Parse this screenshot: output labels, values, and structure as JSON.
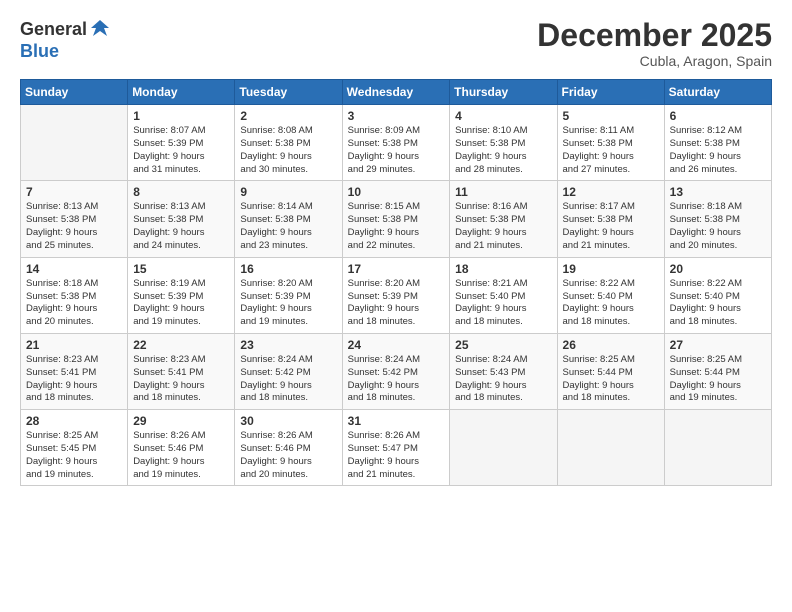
{
  "header": {
    "logo_general": "General",
    "logo_blue": "Blue",
    "month_title": "December 2025",
    "location": "Cubla, Aragon, Spain"
  },
  "weekdays": [
    "Sunday",
    "Monday",
    "Tuesday",
    "Wednesday",
    "Thursday",
    "Friday",
    "Saturday"
  ],
  "weeks": [
    [
      {
        "day": "",
        "info": ""
      },
      {
        "day": "1",
        "info": "Sunrise: 8:07 AM\nSunset: 5:39 PM\nDaylight: 9 hours\nand 31 minutes."
      },
      {
        "day": "2",
        "info": "Sunrise: 8:08 AM\nSunset: 5:38 PM\nDaylight: 9 hours\nand 30 minutes."
      },
      {
        "day": "3",
        "info": "Sunrise: 8:09 AM\nSunset: 5:38 PM\nDaylight: 9 hours\nand 29 minutes."
      },
      {
        "day": "4",
        "info": "Sunrise: 8:10 AM\nSunset: 5:38 PM\nDaylight: 9 hours\nand 28 minutes."
      },
      {
        "day": "5",
        "info": "Sunrise: 8:11 AM\nSunset: 5:38 PM\nDaylight: 9 hours\nand 27 minutes."
      },
      {
        "day": "6",
        "info": "Sunrise: 8:12 AM\nSunset: 5:38 PM\nDaylight: 9 hours\nand 26 minutes."
      }
    ],
    [
      {
        "day": "7",
        "info": "Sunrise: 8:13 AM\nSunset: 5:38 PM\nDaylight: 9 hours\nand 25 minutes."
      },
      {
        "day": "8",
        "info": "Sunrise: 8:13 AM\nSunset: 5:38 PM\nDaylight: 9 hours\nand 24 minutes."
      },
      {
        "day": "9",
        "info": "Sunrise: 8:14 AM\nSunset: 5:38 PM\nDaylight: 9 hours\nand 23 minutes."
      },
      {
        "day": "10",
        "info": "Sunrise: 8:15 AM\nSunset: 5:38 PM\nDaylight: 9 hours\nand 22 minutes."
      },
      {
        "day": "11",
        "info": "Sunrise: 8:16 AM\nSunset: 5:38 PM\nDaylight: 9 hours\nand 21 minutes."
      },
      {
        "day": "12",
        "info": "Sunrise: 8:17 AM\nSunset: 5:38 PM\nDaylight: 9 hours\nand 21 minutes."
      },
      {
        "day": "13",
        "info": "Sunrise: 8:18 AM\nSunset: 5:38 PM\nDaylight: 9 hours\nand 20 minutes."
      }
    ],
    [
      {
        "day": "14",
        "info": "Sunrise: 8:18 AM\nSunset: 5:38 PM\nDaylight: 9 hours\nand 20 minutes."
      },
      {
        "day": "15",
        "info": "Sunrise: 8:19 AM\nSunset: 5:39 PM\nDaylight: 9 hours\nand 19 minutes."
      },
      {
        "day": "16",
        "info": "Sunrise: 8:20 AM\nSunset: 5:39 PM\nDaylight: 9 hours\nand 19 minutes."
      },
      {
        "day": "17",
        "info": "Sunrise: 8:20 AM\nSunset: 5:39 PM\nDaylight: 9 hours\nand 18 minutes."
      },
      {
        "day": "18",
        "info": "Sunrise: 8:21 AM\nSunset: 5:40 PM\nDaylight: 9 hours\nand 18 minutes."
      },
      {
        "day": "19",
        "info": "Sunrise: 8:22 AM\nSunset: 5:40 PM\nDaylight: 9 hours\nand 18 minutes."
      },
      {
        "day": "20",
        "info": "Sunrise: 8:22 AM\nSunset: 5:40 PM\nDaylight: 9 hours\nand 18 minutes."
      }
    ],
    [
      {
        "day": "21",
        "info": "Sunrise: 8:23 AM\nSunset: 5:41 PM\nDaylight: 9 hours\nand 18 minutes."
      },
      {
        "day": "22",
        "info": "Sunrise: 8:23 AM\nSunset: 5:41 PM\nDaylight: 9 hours\nand 18 minutes."
      },
      {
        "day": "23",
        "info": "Sunrise: 8:24 AM\nSunset: 5:42 PM\nDaylight: 9 hours\nand 18 minutes."
      },
      {
        "day": "24",
        "info": "Sunrise: 8:24 AM\nSunset: 5:42 PM\nDaylight: 9 hours\nand 18 minutes."
      },
      {
        "day": "25",
        "info": "Sunrise: 8:24 AM\nSunset: 5:43 PM\nDaylight: 9 hours\nand 18 minutes."
      },
      {
        "day": "26",
        "info": "Sunrise: 8:25 AM\nSunset: 5:44 PM\nDaylight: 9 hours\nand 18 minutes."
      },
      {
        "day": "27",
        "info": "Sunrise: 8:25 AM\nSunset: 5:44 PM\nDaylight: 9 hours\nand 19 minutes."
      }
    ],
    [
      {
        "day": "28",
        "info": "Sunrise: 8:25 AM\nSunset: 5:45 PM\nDaylight: 9 hours\nand 19 minutes."
      },
      {
        "day": "29",
        "info": "Sunrise: 8:26 AM\nSunset: 5:46 PM\nDaylight: 9 hours\nand 19 minutes."
      },
      {
        "day": "30",
        "info": "Sunrise: 8:26 AM\nSunset: 5:46 PM\nDaylight: 9 hours\nand 20 minutes."
      },
      {
        "day": "31",
        "info": "Sunrise: 8:26 AM\nSunset: 5:47 PM\nDaylight: 9 hours\nand 21 minutes."
      },
      {
        "day": "",
        "info": ""
      },
      {
        "day": "",
        "info": ""
      },
      {
        "day": "",
        "info": ""
      }
    ]
  ]
}
